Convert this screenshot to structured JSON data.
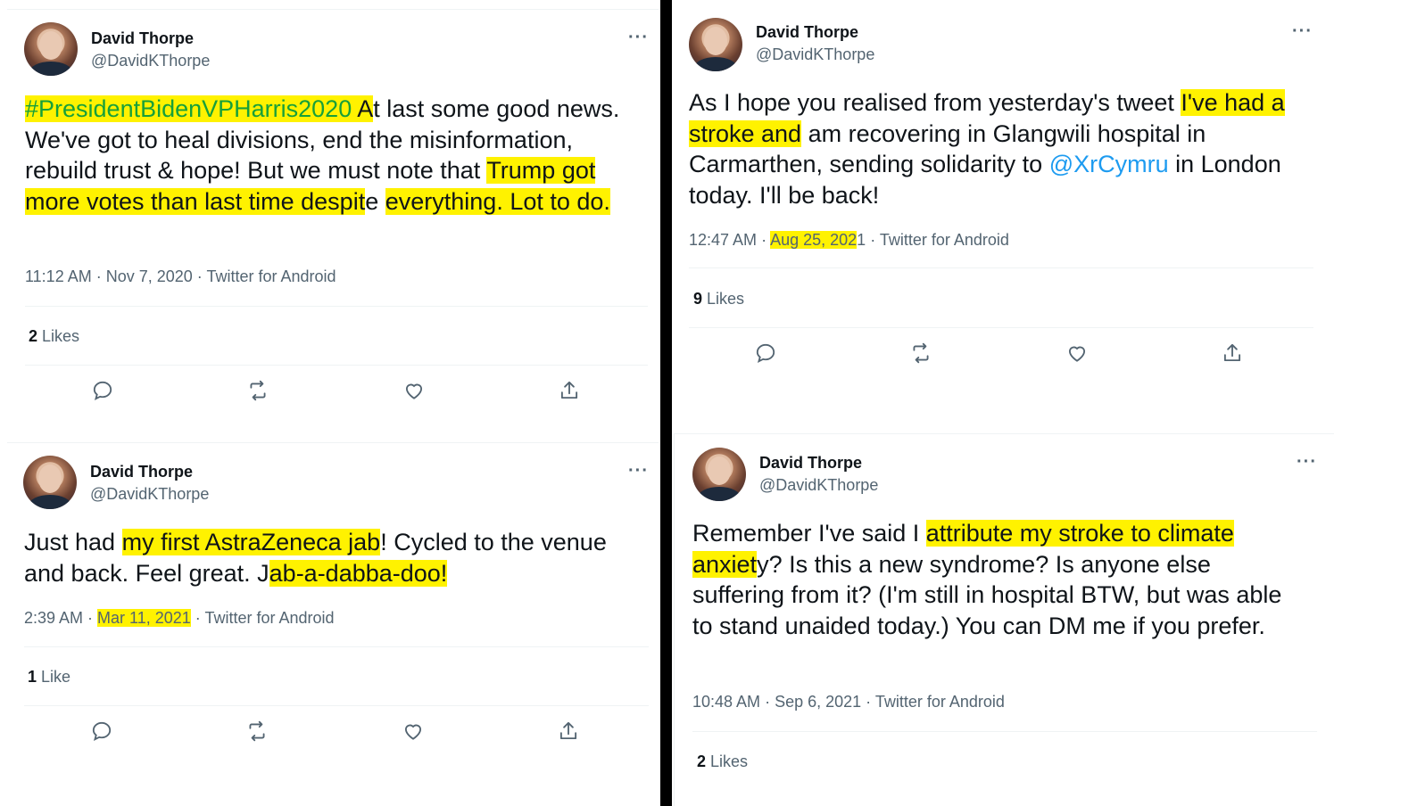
{
  "author": {
    "name": "David Thorpe",
    "handle": "@DavidKThorpe"
  },
  "tweets": [
    {
      "more": "···",
      "text_parts": [
        "#PresidentBidenVPHarris2020",
        " A",
        "t last some good news. We've got to heal divisions, end the misinformation, rebuild trust & hope! But we must note that ",
        "Trump got more votes than last time",
        " despit",
        "e",
        " ",
        "everything. Lot to do."
      ],
      "time": "11:12 AM",
      "date": "Nov 7, 2020",
      "source": "Twitter for Android",
      "likes_count": "2",
      "likes_label": "Likes"
    },
    {
      "more": "···",
      "text_parts": [
        "As I hope you realised from yesterday's tweet ",
        "I've had a stroke and",
        " am recovering in Glangwili hospital in Carmarthen, sending solidarity to ",
        "@XrCymru",
        " in London today. I'll be back!"
      ],
      "time": "12:47 AM",
      "date_hl": "Aug 25, 202",
      "date_rest": "1",
      "source": "Twitter for Android",
      "likes_count": "9",
      "likes_label": "Likes"
    },
    {
      "more": "···",
      "text_parts": [
        "Just had ",
        "my first AstraZeneca jab",
        "! Cycled to the venue and back. Feel great. J",
        "ab-a-dabba-doo!"
      ],
      "time": "2:39 AM",
      "date": "Mar 11, 2021",
      "source": "Twitter for Android",
      "likes_count": "1",
      "likes_label": "Like"
    },
    {
      "more": "···",
      "text_parts": [
        "Remember I've said I ",
        "attribute my stroke to climate anxiet",
        "y? Is this a new syndrome? Is anyone else suffering from it? (I'm still in hospital BTW, but was able to stand unaided today.) You can DM me if you prefer."
      ],
      "time": "10:48 AM",
      "date": "Sep 6, 2021",
      "source": "Twitter for Android",
      "likes_count": "2",
      "likes_label": "Likes"
    }
  ],
  "meta_separator": " · ",
  "icons": [
    "reply-icon",
    "retweet-icon",
    "like-icon",
    "share-icon"
  ],
  "colors": {
    "highlight": "#fff200",
    "hashtag": "#17a03a",
    "link": "#1d9bf0",
    "secondary_text": "#536471"
  }
}
